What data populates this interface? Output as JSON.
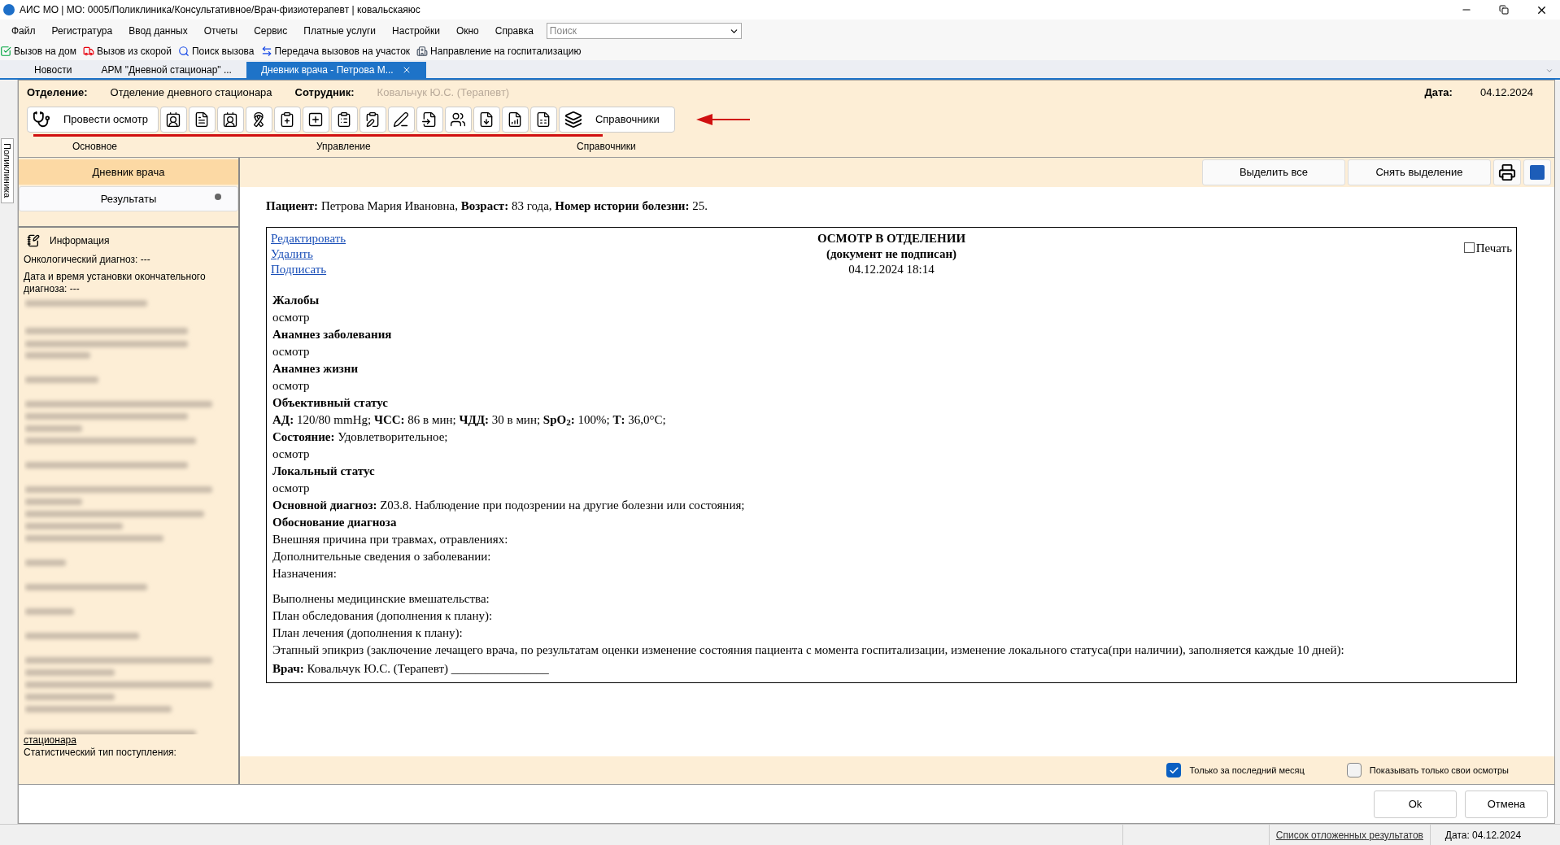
{
  "window": {
    "title": "АИС МО | МО: 0005/Поликлиника/Консультативное/Врач-физиотерапевт | ковальскаяюс"
  },
  "menu": [
    "Файл",
    "Регистратура",
    "Ввод данных",
    "Отчеты",
    "Сервис",
    "Платные услуги",
    "Настройки",
    "Окно",
    "Справка"
  ],
  "search": {
    "placeholder": "Поиск"
  },
  "quick_toolbar": [
    {
      "kind": "home",
      "label": "Вызов на дом"
    },
    {
      "kind": "ambulance",
      "label": "Вызов из скорой"
    },
    {
      "kind": "search",
      "label": "Поиск вызова"
    },
    {
      "kind": "transfer",
      "label": "Передача вызовов на участок"
    },
    {
      "kind": "hospital",
      "label": "Направление на госпитализацию"
    }
  ],
  "tabs": [
    {
      "label": "Новости",
      "selected": false,
      "closable": false
    },
    {
      "label": "АРМ \"Дневной стационар\" ...",
      "selected": false,
      "closable": false
    },
    {
      "label": "Дневник врача - Петрова М...",
      "selected": true,
      "closable": true
    }
  ],
  "side_tab": "Поликлиника",
  "header": {
    "department_label": "Отделение:",
    "department": "Отделение дневного стационара",
    "employee_label": "Сотрудник:",
    "employee": "Ковальчук Ю.С. (Терапевт)",
    "date_label": "Дата:",
    "date": "04.12.2024"
  },
  "ribbon": {
    "primary_button": "Провести осмотр",
    "reference_button": "Справочники",
    "groups": [
      "Основное",
      "Управление",
      "Справочники"
    ]
  },
  "sidebar": {
    "items": [
      {
        "label": "Дневник врача",
        "selected": true,
        "badge": false
      },
      {
        "label": "Результаты",
        "selected": false,
        "badge": true
      }
    ],
    "info_title": "Информация",
    "info_lines": [
      "Онкологический диагноз: ---",
      "Дата и время установки окончательного диагноза: ---"
    ],
    "info_tail": [
      {
        "kind": "link",
        "text": "стационара"
      },
      {
        "kind": "text",
        "text": "Статистический тип поступления:"
      }
    ]
  },
  "actions": [
    "Выделить все",
    "Снять выделение"
  ],
  "document": {
    "patient": "**Пациент:** Петрова Мария Ивановна, **Возраст:** 83 года, **Номер истории болезни:** 25.",
    "links": [
      "Редактировать",
      "Удалить",
      "Подписать"
    ],
    "title": "ОСМОТР В ОТДЕЛЕНИИ",
    "subtitle": "(документ не подписан)",
    "datetime": "04.12.2024 18:14",
    "print": {
      "label": "Печать",
      "checked": false
    },
    "lines": [
      {
        "kind": "heading",
        "text": "Жалобы"
      },
      {
        "kind": "text",
        "text": "осмотр"
      },
      {
        "kind": "heading",
        "text": "Анамнез заболевания"
      },
      {
        "kind": "text",
        "text": "осмотр"
      },
      {
        "kind": "heading",
        "text": "Анамнез жизни"
      },
      {
        "kind": "text",
        "text": "осмотр"
      },
      {
        "kind": "heading",
        "text": "Объективный статус"
      },
      {
        "kind": "text",
        "text": "**АД:** 120/80 mmHg; **ЧСС:** 86 в мин; **ЧДД:** 30 в мин; **SpO$_{2}$:** 100%; **Т:** 36,0°C;"
      },
      {
        "kind": "text",
        "text": "**Состояние:** Удовлетворительное;"
      },
      {
        "kind": "text",
        "text": "осмотр"
      },
      {
        "kind": "heading",
        "text": "Локальный статус"
      },
      {
        "kind": "text",
        "text": "осмотр"
      },
      {
        "kind": "text",
        "text": "**Основной диагноз:** Z03.8. Наблюдение при подозрении на другие болезни или состояния;"
      },
      {
        "kind": "heading",
        "text": "Обоснование диагноза"
      },
      {
        "kind": "text",
        "text": "Внешняя причина при травмах, отравлениях:"
      },
      {
        "kind": "text",
        "text": "Дополнительные сведения о заболевании:"
      },
      {
        "kind": "text",
        "text": "Назначения:"
      },
      {
        "kind": "gap"
      },
      {
        "kind": "text",
        "text": "Выполнены медицинские вмешательства:"
      },
      {
        "kind": "text",
        "text": "План обследования (дополнения к плану):"
      },
      {
        "kind": "text",
        "text": "План лечения (дополнения к плану):"
      },
      {
        "kind": "text",
        "text": "Этапный эпикриз (заключение лечащего врача, по результатам оценки изменение состояния  пациента  с момента госпитализации, изменение локального статуса(при наличии), заполняется каждые 10 дней):"
      },
      {
        "kind": "signature",
        "text": "**Врач:** Ковальчук Ю.С. (Терапевт) ________________"
      }
    ]
  },
  "filters": [
    {
      "label": "Только за последний месяц",
      "checked": true
    },
    {
      "label": "Показывать только свои осмотры",
      "checked": false
    }
  ],
  "dialog_buttons": [
    "Ok",
    "Отмена"
  ],
  "status_bar": {
    "link": "Список отложенных результатов",
    "date": "Дата: 04.12.2024"
  }
}
